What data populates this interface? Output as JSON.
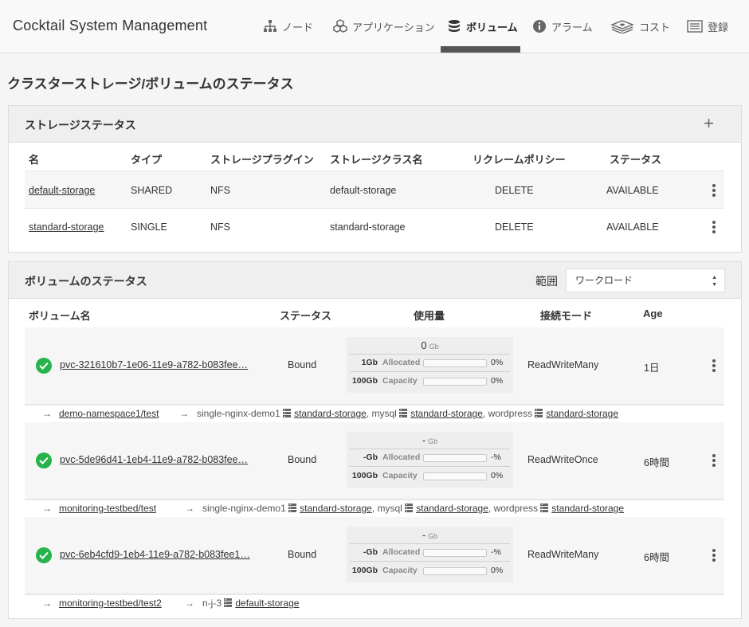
{
  "header": {
    "app_title": "Cocktail System Management",
    "nav": [
      {
        "label": "ノード",
        "icon": "sitemap-icon"
      },
      {
        "label": "アプリケーション",
        "icon": "cubes-icon"
      },
      {
        "label": "ボリューム",
        "icon": "database-icon",
        "active": true
      },
      {
        "label": "アラーム",
        "icon": "info-circle-icon"
      },
      {
        "label": "コスト",
        "icon": "money-stack-icon"
      },
      {
        "label": "登録",
        "icon": "list-icon"
      }
    ]
  },
  "page_title": "クラスターストレージ/ボリュームのステータス",
  "storage_panel": {
    "title": "ストレージステータス",
    "add_label": "+",
    "columns": [
      "名",
      "タイプ",
      "ストレージプラグイン",
      "ストレージクラス名",
      "リクレームポリシー",
      "ステータス"
    ],
    "rows": [
      {
        "name": "default-storage",
        "type": "SHARED",
        "plugin": "NFS",
        "class_name": "default-storage",
        "reclaim": "DELETE",
        "status": "AVAILABLE"
      },
      {
        "name": "standard-storage",
        "type": "SINGLE",
        "plugin": "NFS",
        "class_name": "standard-storage",
        "reclaim": "DELETE",
        "status": "AVAILABLE"
      }
    ]
  },
  "volume_panel": {
    "title": "ボリュームのステータス",
    "scope_label": "範囲",
    "scope_value": "ワークロード",
    "columns": [
      "ボリューム名",
      "ステータス",
      "使用量",
      "接続モード",
      "Age"
    ],
    "unit": "Gb",
    "allocated_label": "Allocated",
    "capacity_label": "Capacity",
    "rows": [
      {
        "name": "pvc-321610b7-1e06-11e9-a782-b083fee…",
        "status": "Bound",
        "usage_total": "0",
        "allocated": "1Gb",
        "allocated_pct": "0%",
        "allocated_fill": 0,
        "capacity": "100Gb",
        "capacity_pct": "0%",
        "capacity_fill": 0,
        "access_mode": "ReadWriteMany",
        "age": "1日",
        "namespace": "demo-namespace1/test",
        "workload": "single-nginx-demo1",
        "mounts": [
          {
            "container": "",
            "storage": "standard-storage",
            "sep": ", "
          },
          {
            "container": "mysql",
            "storage": "standard-storage",
            "sep": ", "
          },
          {
            "container": "wordpress",
            "storage": "standard-storage",
            "sep": ""
          }
        ]
      },
      {
        "name": "pvc-5de96d41-1eb4-11e9-a782-b083fee…",
        "status": "Bound",
        "usage_total": "-",
        "allocated": "-Gb",
        "allocated_pct": "-%",
        "allocated_fill": 0,
        "capacity": "100Gb",
        "capacity_pct": "0%",
        "capacity_fill": 0,
        "access_mode": "ReadWriteOnce",
        "age": "6時間",
        "namespace": "monitoring-testbed/test",
        "workload": "single-nginx-demo1",
        "mounts": [
          {
            "container": "",
            "storage": "standard-storage",
            "sep": ", "
          },
          {
            "container": "mysql",
            "storage": "standard-storage",
            "sep": ", "
          },
          {
            "container": "wordpress",
            "storage": "standard-storage",
            "sep": ""
          }
        ]
      },
      {
        "name": "pvc-6eb4cfd9-1eb4-11e9-a782-b083fee1…",
        "status": "Bound",
        "usage_total": "-",
        "allocated": "-Gb",
        "allocated_pct": "-%",
        "allocated_fill": 0,
        "capacity": "100Gb",
        "capacity_pct": "0%",
        "capacity_fill": 0,
        "access_mode": "ReadWriteMany",
        "age": "6時間",
        "namespace": "monitoring-testbed/test2",
        "workload": "n-j-3",
        "mounts": [
          {
            "container": "",
            "storage": "default-storage",
            "sep": ""
          }
        ]
      }
    ]
  },
  "colors": {
    "accent": "#555555",
    "success": "#27b34c",
    "panel_head": "#efefef",
    "row_bg": "#f6f6f6"
  }
}
